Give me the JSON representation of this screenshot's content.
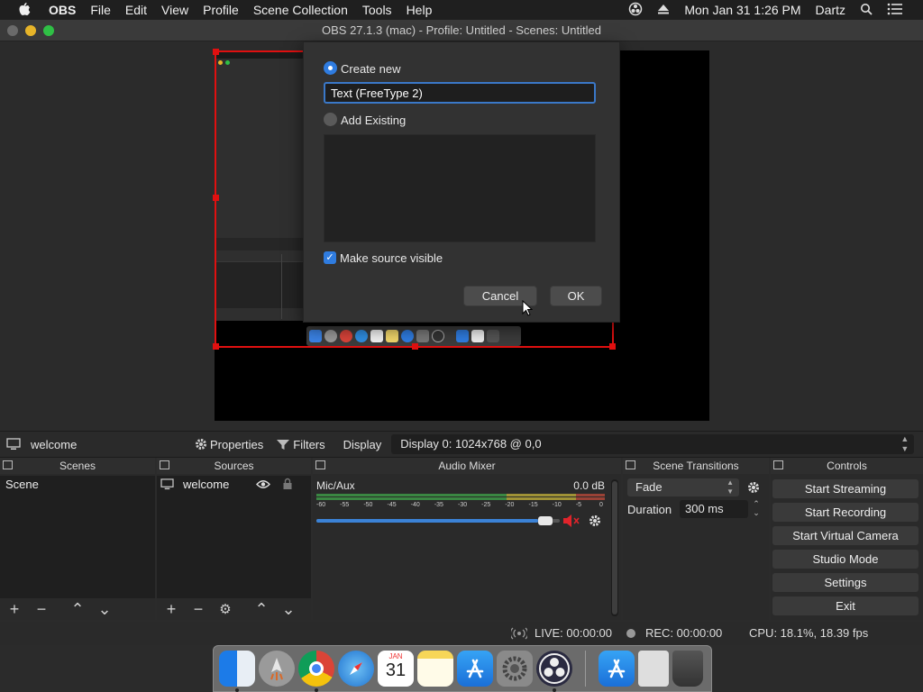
{
  "menubar": {
    "items": [
      "OBS",
      "File",
      "Edit",
      "View",
      "Profile",
      "Scene Collection",
      "Tools",
      "Help"
    ],
    "clock": "Mon Jan 31  1:26 PM",
    "user": "Dartz"
  },
  "window": {
    "title": "OBS 27.1.3 (mac) - Profile: Untitled - Scenes: Untitled"
  },
  "dialog": {
    "create_new_label": "Create new",
    "name_value": "Text (FreeType 2)",
    "add_existing_label": "Add Existing",
    "visible_label": "Make source visible",
    "cancel": "Cancel",
    "ok": "OK"
  },
  "toolbar": {
    "source_name": "welcome",
    "properties": "Properties",
    "filters": "Filters",
    "display": "Display",
    "display_value": "Display 0: 1024x768 @ 0,0"
  },
  "scenes": {
    "title": "Scenes",
    "items": [
      "Scene"
    ]
  },
  "sources": {
    "title": "Sources",
    "items": [
      "welcome"
    ]
  },
  "mixer": {
    "title": "Audio Mixer",
    "channel": "Mic/Aux",
    "level": "0.0 dB",
    "ticks": [
      "-60",
      "-55",
      "-50",
      "-45",
      "-40",
      "-35",
      "-30",
      "-25",
      "-20",
      "-15",
      "-10",
      "-5",
      "0"
    ],
    "volume_fraction": 0.97,
    "muted": true
  },
  "transitions": {
    "title": "Scene Transitions",
    "type": "Fade",
    "duration_label": "Duration",
    "duration": "300 ms"
  },
  "controls": {
    "title": "Controls",
    "buttons": [
      "Start Streaming",
      "Start Recording",
      "Start Virtual Camera",
      "Studio Mode",
      "Settings",
      "Exit"
    ]
  },
  "status": {
    "live": "LIVE: 00:00:00",
    "rec": "REC: 00:00:00",
    "cpu": "CPU: 18.1%, 18.39 fps"
  },
  "calendar": {
    "month": "JAN",
    "day": "31"
  },
  "colors": {
    "accent": "#2f7ce0",
    "selection": "#e01010",
    "meter_green": "#3fa64a",
    "meter_yellow": "#c8b43a"
  }
}
